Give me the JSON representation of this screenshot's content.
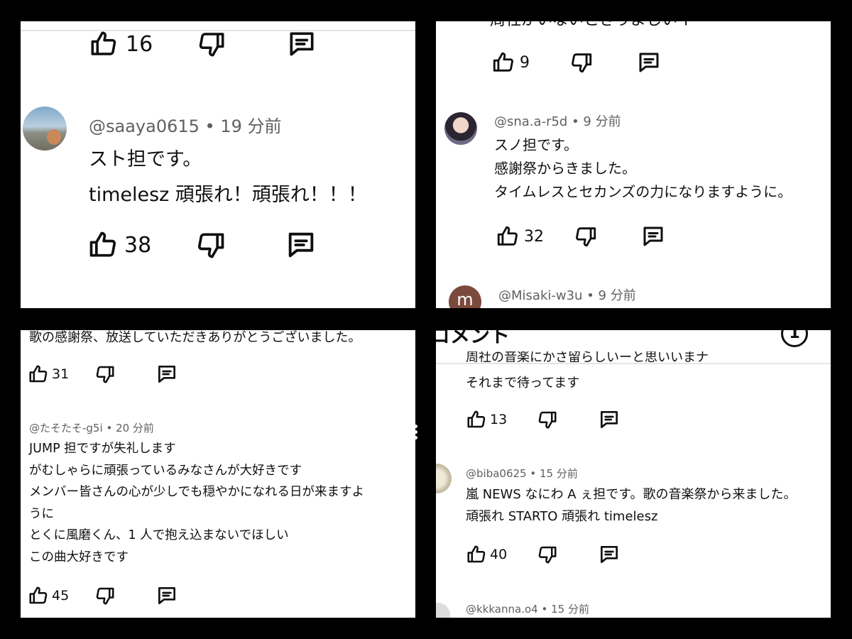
{
  "panel1": {
    "top_actions": {
      "likes": "16"
    },
    "comment": {
      "handle": "@saaya0615",
      "time": "19 分前",
      "lines": [
        "スト担です。",
        "timelesz 頑張れ！頑張れ！！！"
      ],
      "likes": "38"
    }
  },
  "panel2": {
    "clipped_text": "周社がいないときりよしいイ・〜",
    "top_actions": {
      "likes": "9"
    },
    "comment": {
      "handle": "@sna.a-r5d",
      "time": "9 分前",
      "lines": [
        "スノ担です。",
        "感謝祭からきました。",
        "タイムレスとセカンズの力になりますように。"
      ],
      "likes": "32"
    },
    "next": {
      "avatar_letter": "m",
      "handle": "@Misaki-w3u",
      "time": "9 分前"
    }
  },
  "panel3": {
    "top_text": "歌の感謝祭、放送していただきありがとうございました。",
    "top_actions": {
      "likes": "31"
    },
    "comment": {
      "handle": "@たそたそ-g5i",
      "time": "20 分前",
      "lines": [
        "JUMP 担ですが失礼します",
        "がむしゃらに頑張っているみなさんが大好きです",
        "メンバー皆さんの心が少しでも穏やかになれる日が来ますよ",
        "うに",
        "とくに風磨くん、1 人で抱え込まないでほしい",
        "この曲大好きです"
      ],
      "likes": "45"
    }
  },
  "panel4": {
    "header_title": "コメント",
    "header_badge": "1",
    "clipped_text": "周社の音楽にかさ留らしいーと思いいまナ",
    "top_text": "それまで待ってます",
    "top_actions": {
      "likes": "13"
    },
    "comment": {
      "handle": "@biba0625",
      "time": "15 分前",
      "lines": [
        "嵐 NEWS なにわ A ぇ担です。歌の音楽祭から来ました。",
        "頑張れ STARTO 頑張れ timelesz"
      ],
      "likes": "40"
    },
    "next": {
      "handle": "@kkkanna.o4",
      "time": "15 分前"
    }
  }
}
